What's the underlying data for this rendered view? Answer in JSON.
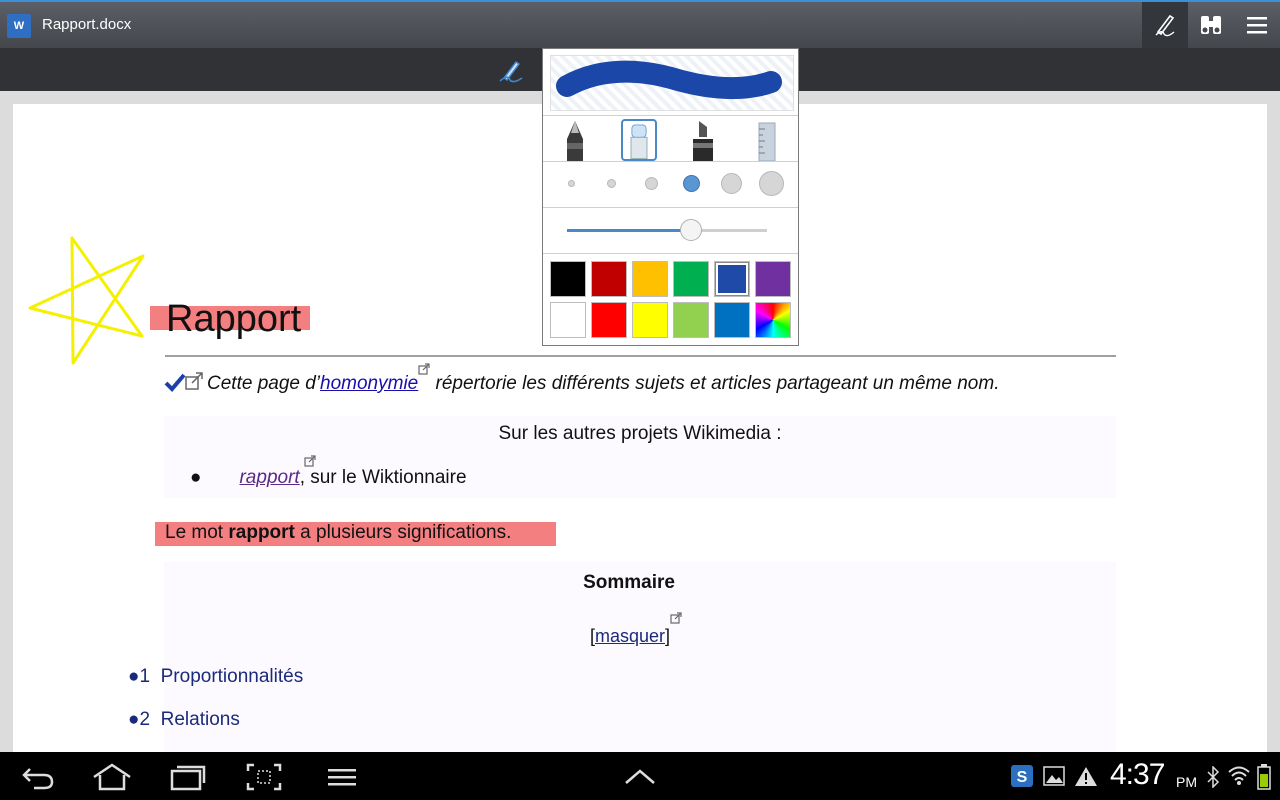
{
  "titlebar": {
    "app_icon_text": "W",
    "doc_title": "Rapport.docx",
    "buttons": [
      {
        "icon": "pen-icon",
        "active": true
      },
      {
        "icon": "binoculars-icon",
        "active": false
      },
      {
        "icon": "menu-icon",
        "active": false
      }
    ]
  },
  "document": {
    "heading": "Rapport",
    "homonymie": {
      "before": "Cette page d’",
      "link": "homonymie",
      "after": " répertorie les différents sujets et articles partageant un même nom."
    },
    "wikimedia_title": "Sur les autres projets Wikimedia :",
    "wiktionnaire": {
      "link": "rapport",
      "after": ", sur le Wiktionnaire"
    },
    "mot_line": {
      "before": "Le mot ",
      "bold": "rapport",
      "after": " a plusieurs significations."
    },
    "sommaire": "Sommaire",
    "masquer": {
      "open": "[",
      "link": "masquer",
      "close": "]"
    },
    "toc": [
      {
        "num": "1",
        "label": "Proportionnalités"
      },
      {
        "num": "2",
        "label": "Relations"
      }
    ]
  },
  "pen_panel": {
    "stroke_color": "#1a47a8",
    "tools": [
      "pen-tool-icon",
      "brush-tool-icon",
      "marker-tool-icon",
      "ruler-tool-icon"
    ],
    "selected_tool": "brush-tool-icon",
    "sizes_selected_index": 3,
    "opacity_fraction": 0.62,
    "colors": [
      "#000000",
      "#c00000",
      "#ffc000",
      "#00b050",
      "#1f4aa8",
      "#7030a0",
      "#ffffff",
      "#ff0000",
      "#ffff00",
      "#92d050",
      "#0070c0",
      "rainbow"
    ],
    "selected_color_index": 4
  },
  "annotations": {
    "star_color": "#f5f000",
    "highlight_color": "#f2686b"
  },
  "statusbar": {
    "time": "4:37",
    "ampm": "PM",
    "icons": [
      "sync-icon",
      "gallery-icon",
      "warning-icon",
      "bluetooth-icon",
      "wifi-icon",
      "battery-icon"
    ]
  },
  "navbar": {
    "buttons": [
      "back-icon",
      "home-icon",
      "recent-apps-icon",
      "screenshot-icon",
      "menu-icon",
      "up-arrow-icon"
    ]
  }
}
